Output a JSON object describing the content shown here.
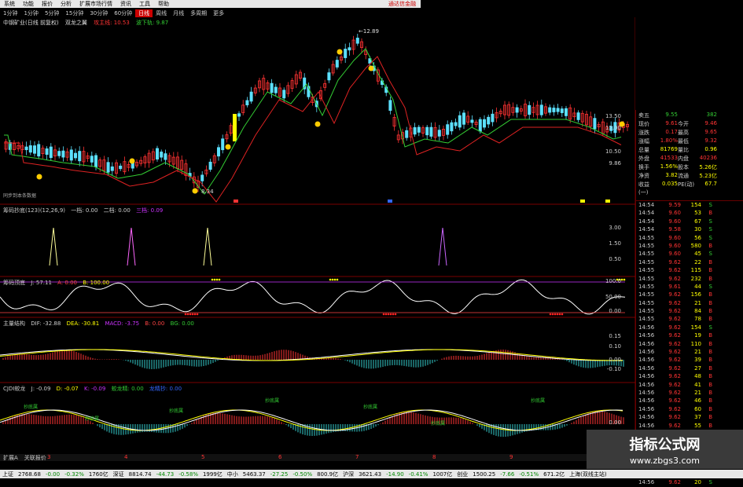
{
  "menubar": {
    "items": [
      "系统",
      "功能",
      "报价",
      "分析",
      "扩展市场行情",
      "资讯",
      "工具",
      "帮助"
    ],
    "alert": "通达信金融"
  },
  "periods": {
    "items": [
      "1分钟",
      "1分钟",
      "5分钟",
      "15分钟",
      "30分钟",
      "60分钟",
      "日线",
      "周线",
      "月线",
      "多周期",
      "更多"
    ],
    "active_index": 6
  },
  "main_title": {
    "stock": "中钢矿业(日线 前复权)",
    "indicator": "双龙之翼",
    "v1": "攻主线: 10.53",
    "v2": "波下轨: 9.87"
  },
  "main_chart": {
    "high_label": "12.89",
    "low_label": "8.34",
    "y_labels": [
      "13.50",
      "12.00",
      "10.50",
      "9.86"
    ],
    "footer": "同步到本条数据"
  },
  "panel2": {
    "name": "筹码抄底(123)(12,26,9)",
    "vals": [
      "一档: 0.00",
      "二档: 0.00",
      "三档: 0.09"
    ],
    "y_labels": [
      "3.00",
      "1.50",
      "0.50"
    ]
  },
  "panel3": {
    "name": "筹码顶底",
    "vals": [
      "J: 57.11",
      "A: 0.00",
      "B: 100.00"
    ],
    "y_labels": [
      "100.0",
      "50.00",
      "0.00"
    ]
  },
  "panel4": {
    "name": "主量结构",
    "vals": [
      "DIF: -32.88",
      "DEA: -30.81",
      "MACD: -3.75",
      "B: 0.00",
      "BG: 0.00"
    ],
    "y_labels": [
      "0.15",
      "0.10",
      "0.00",
      "-0.10"
    ]
  },
  "panel5": {
    "name": "CJDI蛟龙",
    "vals": [
      "J: -0.09",
      "D: -0.07",
      "K: -0.09",
      "蛟龙精: 0.00",
      "龙精抄: 0.00"
    ],
    "labels": [
      "抄底属",
      "抄底属",
      "抄底属",
      "抄底属",
      "抄底属",
      "抄底属",
      "抄底属"
    ],
    "y_labels": [
      "0.00",
      "-0.20"
    ]
  },
  "quote": {
    "rows": [
      [
        "卖五",
        "9.55",
        "",
        "382"
      ],
      [
        "现价",
        "9.61",
        "今开",
        "9.46"
      ],
      [
        "涨跌",
        "0.17",
        "最高",
        "9.65"
      ],
      [
        "涨幅",
        "1.80%",
        "最低",
        "9.32"
      ],
      [
        "总量",
        "81769",
        "量比",
        "0.96"
      ],
      [
        "外盘",
        "41533",
        "内盘",
        "40236"
      ],
      [
        "换手",
        "1.56%",
        "股本",
        "5.26亿"
      ],
      [
        "净资",
        "3.82",
        "流通",
        "5.23亿"
      ],
      [
        "收益(一)",
        "0.035",
        "PE(动)",
        "67.7"
      ]
    ]
  },
  "ticks": [
    [
      "14:54",
      "9.59",
      "154",
      "S"
    ],
    [
      "14:54",
      "9.60",
      "53",
      "B"
    ],
    [
      "14:54",
      "9.60",
      "67",
      "S"
    ],
    [
      "14:54",
      "9.58",
      "30",
      "S"
    ],
    [
      "14:55",
      "9.60",
      "56",
      "S"
    ],
    [
      "14:55",
      "9.60",
      "580",
      "B"
    ],
    [
      "14:55",
      "9.60",
      "45",
      "S"
    ],
    [
      "14:55",
      "9.62",
      "22",
      "B"
    ],
    [
      "14:55",
      "9.62",
      "115",
      "B"
    ],
    [
      "14:55",
      "9.62",
      "232",
      "B"
    ],
    [
      "14:55",
      "9.61",
      "44",
      "S"
    ],
    [
      "14:55",
      "9.62",
      "156",
      "B"
    ],
    [
      "14:55",
      "9.62",
      "21",
      "B"
    ],
    [
      "14:55",
      "9.62",
      "84",
      "B"
    ],
    [
      "14:55",
      "9.62",
      "78",
      "B"
    ],
    [
      "14:56",
      "9.62",
      "154",
      "S"
    ],
    [
      "14:56",
      "9.62",
      "19",
      "B"
    ],
    [
      "14:56",
      "9.62",
      "110",
      "B"
    ],
    [
      "14:56",
      "9.62",
      "21",
      "B"
    ],
    [
      "14:56",
      "9.62",
      "39",
      "B"
    ],
    [
      "14:56",
      "9.62",
      "27",
      "B"
    ],
    [
      "14:56",
      "9.62",
      "48",
      "B"
    ],
    [
      "14:56",
      "9.62",
      "41",
      "B"
    ],
    [
      "14:56",
      "9.62",
      "21",
      "B"
    ],
    [
      "14:56",
      "9.62",
      "46",
      "B"
    ],
    [
      "14:56",
      "9.62",
      "60",
      "B"
    ],
    [
      "14:56",
      "9.62",
      "37",
      "B"
    ],
    [
      "14:56",
      "9.62",
      "55",
      "B"
    ],
    [
      "14:56",
      "9.62",
      "95",
      "B"
    ],
    [
      "14:56",
      "9.62",
      "22",
      "B"
    ],
    [
      "14:56",
      "9.61",
      "32",
      "S"
    ],
    [
      "14:56",
      "9.61",
      "36",
      "S"
    ],
    [
      "14:56",
      "9.62",
      "36",
      "B"
    ],
    [
      "14:56",
      "9.62",
      "17",
      "B"
    ],
    [
      "14:56",
      "9.62",
      "20",
      "S"
    ]
  ],
  "bottom_tabs": [
    "扩展A",
    "关联报价"
  ],
  "x_labels": [
    "3",
    "4",
    "5",
    "6",
    "7",
    "8",
    "9",
    "10"
  ],
  "statusbar": [
    {
      "t": "上证",
      "c": ""
    },
    {
      "t": "2768.68",
      "c": ""
    },
    {
      "t": "-0.00",
      "c": "dn"
    },
    {
      "t": "-0.32%",
      "c": "dn"
    },
    {
      "t": "1760亿",
      "c": ""
    },
    {
      "t": "深证",
      "c": ""
    },
    {
      "t": "8814.74",
      "c": ""
    },
    {
      "t": "-44.73",
      "c": "dn"
    },
    {
      "t": "-0.58%",
      "c": "dn"
    },
    {
      "t": "1999亿",
      "c": ""
    },
    {
      "t": "中小",
      "c": ""
    },
    {
      "t": "5463.37",
      "c": ""
    },
    {
      "t": "-27.25",
      "c": "dn"
    },
    {
      "t": "-0.50%",
      "c": "dn"
    },
    {
      "t": "800.9亿",
      "c": ""
    },
    {
      "t": "沪深",
      "c": ""
    },
    {
      "t": "3621.43",
      "c": ""
    },
    {
      "t": "-14.90",
      "c": "dn"
    },
    {
      "t": "-0.41%",
      "c": "dn"
    },
    {
      "t": "1007亿",
      "c": ""
    },
    {
      "t": "创业",
      "c": ""
    },
    {
      "t": "1500.25",
      "c": ""
    },
    {
      "t": "-7.66",
      "c": "dn"
    },
    {
      "t": "-0.51%",
      "c": "dn"
    },
    {
      "t": "671.2亿",
      "c": ""
    },
    {
      "t": "上海(双线主站)",
      "c": ""
    }
  ],
  "watermark": {
    "line1": "指标公式网",
    "line2": "www.zbgs3.com"
  }
}
